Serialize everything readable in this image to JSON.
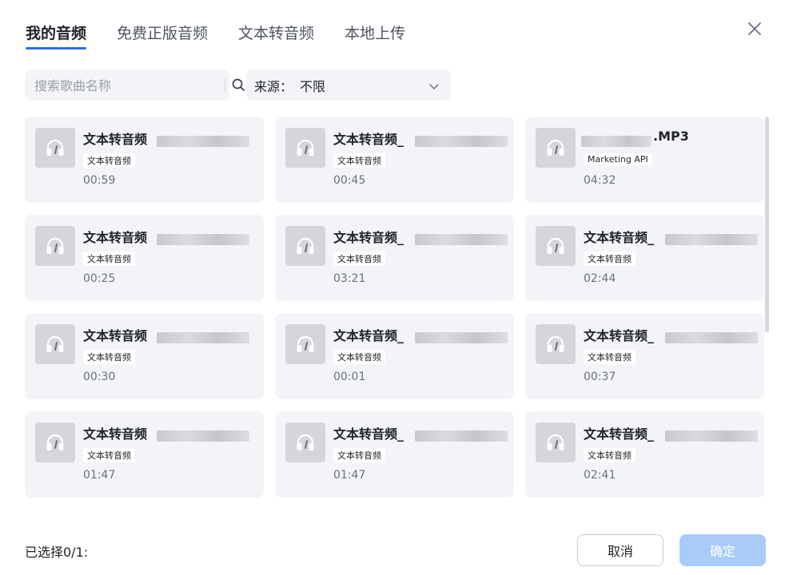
{
  "tabs": [
    {
      "label": "我的音频",
      "active": true
    },
    {
      "label": "免费正版音频",
      "active": false
    },
    {
      "label": "文本转音频",
      "active": false
    },
    {
      "label": "本地上传",
      "active": false
    }
  ],
  "close_icon": "close-icon",
  "search": {
    "placeholder": "搜索歌曲名称",
    "value": "",
    "icon": "search-icon"
  },
  "source": {
    "label": "来源：",
    "value": "不限",
    "icon": "chevron-down-icon"
  },
  "colors": {
    "accent": "#2b6cf0",
    "confirm_disabled": "#a8ccf7",
    "card_bg": "#f3f4f7"
  },
  "audio_items": [
    {
      "title": "文本转音频",
      "tag": "文本转音频",
      "duration": "00:59"
    },
    {
      "title": "文本转音频_",
      "tag": "文本转音频",
      "duration": "00:45"
    },
    {
      "title": ".MP3",
      "tag": "Marketing API",
      "duration": "04:32"
    },
    {
      "title": "文本转音频",
      "tag": "文本转音频",
      "duration": "00:25"
    },
    {
      "title": "文本转音频_",
      "tag": "文本转音频",
      "duration": "03:21"
    },
    {
      "title": "文本转音频_",
      "tag": "文本转音频",
      "duration": "02:44"
    },
    {
      "title": "文本转音频",
      "tag": "文本转音频",
      "duration": "00:30"
    },
    {
      "title": "文本转音频_",
      "tag": "文本转音频",
      "duration": "00:01"
    },
    {
      "title": "文本转音频_",
      "tag": "文本转音频",
      "duration": "00:37"
    },
    {
      "title": "文本转音频",
      "tag": "文本转音频",
      "duration": "01:47"
    },
    {
      "title": "文本转音频_",
      "tag": "文本转音频",
      "duration": "01:47"
    },
    {
      "title": "文本转音频_",
      "tag": "文本转音频",
      "duration": "02:41"
    }
  ],
  "footer": {
    "selection_text": "已选择0/1:",
    "cancel_label": "取消",
    "confirm_label": "确定"
  }
}
